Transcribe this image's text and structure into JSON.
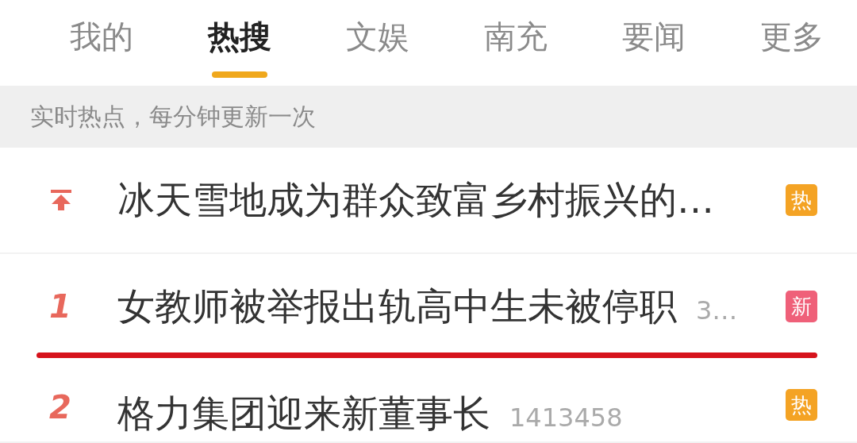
{
  "tabs": [
    {
      "label": "我的",
      "selected": false
    },
    {
      "label": "热搜",
      "selected": true
    },
    {
      "label": "文娱",
      "selected": false
    },
    {
      "label": "南充",
      "selected": false
    },
    {
      "label": "要闻",
      "selected": false
    },
    {
      "label": "更多",
      "selected": false
    }
  ],
  "banner": "实时热点，每分钟更新一次",
  "rows": [
    {
      "rank": {
        "kind": "pinned"
      },
      "title": "冰天雪地成为群众致富乡村振兴的…",
      "badge": {
        "label": "热",
        "color": "#f4a324"
      },
      "underlined": false
    },
    {
      "rank": {
        "kind": "number",
        "text": "1"
      },
      "title": "女教师被举报出轨高中生未被停职",
      "count": "3…",
      "badge": {
        "label": "新",
        "color": "#ef6079"
      },
      "underlined": true
    },
    {
      "rank": {
        "kind": "number",
        "text": "2"
      },
      "title": "格力集团迎来新董事长",
      "count": "1413458",
      "badge": {
        "label": "热",
        "color": "#f4a324"
      },
      "underlined": false
    }
  ]
}
